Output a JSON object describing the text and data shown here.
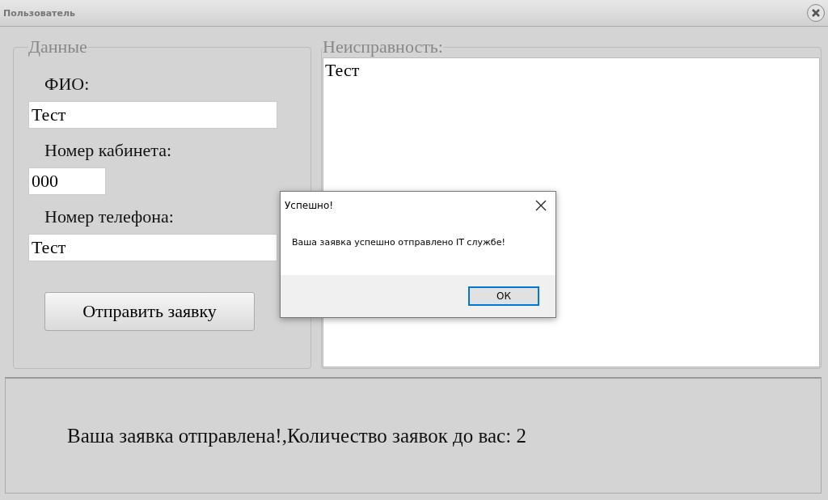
{
  "window": {
    "title": "Пользователь"
  },
  "data_group": {
    "legend": "Данные",
    "fields": [
      {
        "label": "ФИО:",
        "value": "Тест",
        "kind": "wide"
      },
      {
        "label": "Номер кабинета:",
        "value": "000",
        "kind": "narrow"
      },
      {
        "label": "Номер телефона:",
        "value": "Тест",
        "kind": "wide"
      }
    ],
    "submit": "Отправить заявку"
  },
  "fault_group": {
    "legend": "Неисправность:",
    "value": "Тест"
  },
  "status": "Ваша заявка отправлена!,Количество заявок до вас: 2",
  "dialog": {
    "title": "Успешно!",
    "message": "Ваша заявка успешно отправлено IT службе!",
    "button": "ОК"
  }
}
